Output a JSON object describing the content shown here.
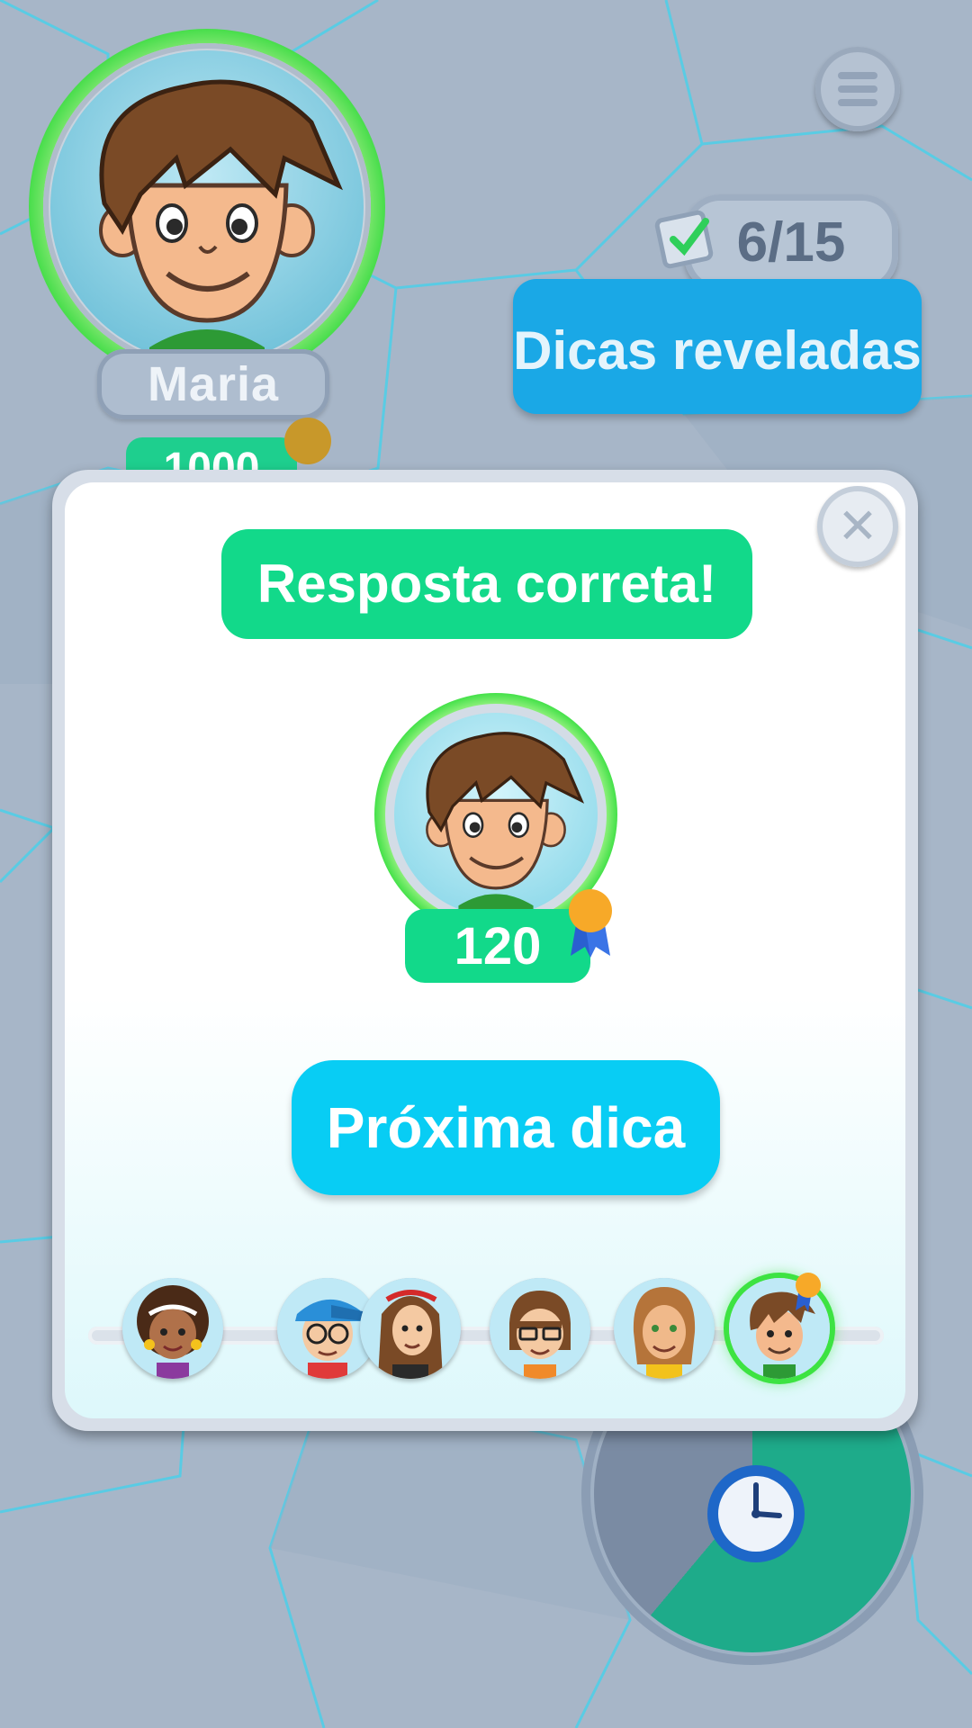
{
  "player": {
    "name": "Maria",
    "score": "1000"
  },
  "hints": {
    "counter": "6/15",
    "revealed_label": "Dicas reveladas"
  },
  "modal": {
    "result_label": "Resposta correta!",
    "points": "120",
    "next_button": "Próxima dica",
    "close_symbol": "✕"
  },
  "players_strip": [
    {
      "id": "player-1",
      "active": false
    },
    {
      "id": "player-2",
      "active": false
    },
    {
      "id": "player-3",
      "active": false
    },
    {
      "id": "player-4",
      "active": false
    },
    {
      "id": "player-5",
      "active": false
    },
    {
      "id": "player-6",
      "active": true
    }
  ],
  "timer": {
    "remaining_fraction": 0.61
  },
  "colors": {
    "correct_green": "#12d98a",
    "primary_blue": "#08cdf4",
    "hint_blue": "#1aa8e6",
    "ring_green": "#3de342",
    "timer_green": "#1eab8a"
  },
  "icons": [
    "menu-icon",
    "checklist-icon",
    "close-icon",
    "medal-icon",
    "clock-icon"
  ]
}
